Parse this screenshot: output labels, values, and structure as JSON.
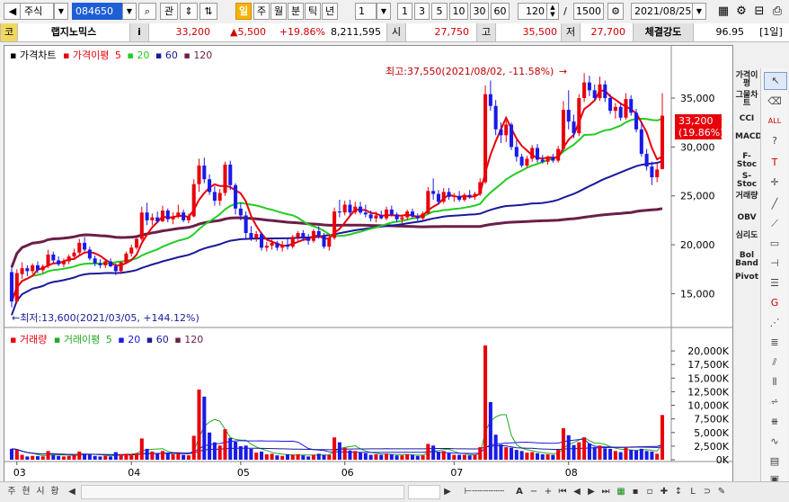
{
  "toolbar": {
    "market": "주식",
    "code": "084650",
    "btn_gwan": "관",
    "periods": [
      "일",
      "주",
      "월",
      "분",
      "틱",
      "년"
    ],
    "period_count": "1",
    "quick_counts": [
      "1",
      "3",
      "5",
      "10",
      "30",
      "60"
    ],
    "display_count": "120",
    "separator": "/",
    "total_count": "1500",
    "date": "2021/08/25"
  },
  "info": {
    "market_abbr": "코",
    "name": "랩지노믹스",
    "info_btn": "i",
    "price": "33,200",
    "change": "▲5,500",
    "change_rate": "+19.86%",
    "volume": "8,211,595",
    "open_label": "시",
    "open": "27,750",
    "high_label": "고",
    "high": "35,500",
    "low_label": "저",
    "low": "27,700",
    "strength_label": "체결강도",
    "strength": "96.95",
    "period_tag": "[1일]"
  },
  "price_panel": {
    "legend_title": "가격차트",
    "legend_ma_label": "가격이평",
    "legend_ma": [
      "5",
      "20",
      "60",
      "120"
    ],
    "max_note": "최고:37,550(2021/08/02, -11.58%)",
    "max_arrow": "→",
    "min_note": "←최저:13,600(2021/03/05, +144.12%)",
    "y_ticks": [
      "35,000",
      "30,000",
      "25,000",
      "20,000",
      "15,000"
    ],
    "current_price_tag": "33,200",
    "current_rate_tag": "(19.86%)"
  },
  "volume_panel": {
    "legend_title": "거래량",
    "legend_ma_label": "거래이평",
    "legend_ma": [
      "5",
      "20",
      "60",
      "120"
    ],
    "y_ticks": [
      "20,000K",
      "17,500K",
      "15,000K",
      "12,500K",
      "10,000K",
      "7,500K",
      "5,000K",
      "2,500K",
      "0K"
    ]
  },
  "x_ticks": [
    "03",
    "04",
    "05",
    "06",
    "07",
    "08"
  ],
  "colors": {
    "up": "#e8000b",
    "down": "#1a1ae6",
    "ma5": "#e8000b",
    "ma20": "#22cc22",
    "ma60": "#1a1a9a",
    "ma120": "#6b1f48"
  },
  "indicators": [
    "가격이평",
    "그물차트",
    "CCI",
    "MACD",
    "F-Stoc",
    "S-Stoc",
    "거래량",
    "OBV",
    "심리도",
    "Bol Band",
    "Pivot"
  ],
  "bottom": {
    "tabs": [
      "주",
      "현",
      "시",
      "황"
    ],
    "zoom_label": "A"
  },
  "chart_data": {
    "type": "candlestick",
    "dates_range": [
      "2021/02/26",
      "2021/08/25"
    ],
    "ylim_price": [
      12000,
      38500
    ],
    "ylim_volume_k": [
      0,
      21000
    ],
    "points_ohlc_vol_k": [
      [
        17200,
        17800,
        13600,
        14200,
        2000
      ],
      [
        14200,
        17500,
        14000,
        17100,
        1800
      ],
      [
        17000,
        18200,
        16500,
        17600,
        900
      ],
      [
        17600,
        17900,
        16800,
        17300,
        600
      ],
      [
        17300,
        18100,
        17000,
        17900,
        700
      ],
      [
        17900,
        18300,
        17100,
        17400,
        650
      ],
      [
        17400,
        18000,
        17100,
        17800,
        600
      ],
      [
        17800,
        19500,
        17600,
        19000,
        1600
      ],
      [
        19000,
        19300,
        18100,
        18400,
        900
      ],
      [
        18400,
        18800,
        17800,
        18000,
        700
      ],
      [
        18000,
        18600,
        17700,
        18300,
        600
      ],
      [
        18300,
        19000,
        18000,
        18800,
        700
      ],
      [
        18800,
        19600,
        18500,
        19200,
        800
      ],
      [
        19200,
        20600,
        19000,
        20200,
        1500
      ],
      [
        20200,
        20800,
        19300,
        19500,
        1100
      ],
      [
        19500,
        19800,
        18400,
        18600,
        900
      ],
      [
        18600,
        18900,
        17800,
        18100,
        700
      ],
      [
        18100,
        18500,
        17600,
        17900,
        600
      ],
      [
        17900,
        18500,
        17600,
        18300,
        700
      ],
      [
        18300,
        18600,
        17700,
        17800,
        600
      ],
      [
        17800,
        18100,
        16900,
        17300,
        1400
      ],
      [
        17300,
        18300,
        17000,
        18200,
        1000
      ],
      [
        18200,
        19300,
        18000,
        19100,
        1100
      ],
      [
        19100,
        20000,
        18800,
        19700,
        1000
      ],
      [
        19700,
        20700,
        19500,
        20600,
        1200
      ],
      [
        20600,
        23900,
        20400,
        23300,
        3900
      ],
      [
        23300,
        24300,
        22000,
        22500,
        2000
      ],
      [
        22500,
        23200,
        22000,
        22800,
        1500
      ],
      [
        22800,
        23400,
        22200,
        22400,
        1200
      ],
      [
        22400,
        24000,
        22300,
        23500,
        1600
      ],
      [
        23500,
        23700,
        22300,
        22600,
        1300
      ],
      [
        22600,
        23300,
        22100,
        22900,
        1000
      ],
      [
        22900,
        24100,
        22700,
        23300,
        1200
      ],
      [
        23300,
        23600,
        22300,
        22500,
        900
      ],
      [
        22500,
        23200,
        22200,
        22900,
        800
      ],
      [
        22900,
        26700,
        22800,
        26200,
        4400
      ],
      [
        26200,
        28800,
        25400,
        28100,
        12900
      ],
      [
        28100,
        28900,
        26300,
        26700,
        11600
      ],
      [
        26700,
        27200,
        25100,
        25400,
        5000
      ],
      [
        25400,
        26000,
        24000,
        24500,
        3200
      ],
      [
        24500,
        25700,
        24000,
        25300,
        2600
      ],
      [
        25300,
        28500,
        25000,
        28200,
        5600
      ],
      [
        28200,
        28600,
        25600,
        26100,
        4000
      ],
      [
        26100,
        26300,
        23100,
        23700,
        3300
      ],
      [
        23700,
        24300,
        22500,
        23000,
        2500
      ],
      [
        23000,
        23400,
        20500,
        21200,
        2600
      ],
      [
        21200,
        21900,
        20400,
        20700,
        2000
      ],
      [
        20700,
        21400,
        20300,
        21100,
        1300
      ],
      [
        21100,
        21300,
        19400,
        19700,
        1500
      ],
      [
        19700,
        20300,
        19300,
        19900,
        1000
      ],
      [
        19900,
        20600,
        19500,
        20200,
        1100
      ],
      [
        20200,
        20400,
        19400,
        19700,
        800
      ],
      [
        19700,
        20400,
        19300,
        20000,
        700
      ],
      [
        20000,
        20700,
        19500,
        19800,
        1000
      ],
      [
        19800,
        21000,
        19600,
        20800,
        900
      ],
      [
        20800,
        21400,
        20400,
        21200,
        1000
      ],
      [
        21200,
        21500,
        20400,
        20700,
        800
      ],
      [
        20700,
        21100,
        20000,
        20400,
        600
      ],
      [
        20400,
        21600,
        20200,
        21400,
        900
      ],
      [
        21400,
        21900,
        20600,
        20900,
        1100
      ],
      [
        20900,
        21200,
        19600,
        19800,
        900
      ],
      [
        19800,
        21100,
        19400,
        20700,
        900
      ],
      [
        20700,
        23800,
        20500,
        23400,
        4100
      ],
      [
        23400,
        24600,
        22800,
        23300,
        3200
      ],
      [
        23300,
        24500,
        23000,
        24100,
        2200
      ],
      [
        24100,
        24600,
        23000,
        23300,
        1700
      ],
      [
        23300,
        24400,
        23100,
        23900,
        1600
      ],
      [
        23900,
        24400,
        23100,
        23300,
        1300
      ],
      [
        23300,
        24100,
        22800,
        23100,
        1200
      ],
      [
        23100,
        23500,
        22400,
        22700,
        900
      ],
      [
        22700,
        23400,
        22300,
        23000,
        1000
      ],
      [
        23000,
        23500,
        22600,
        22700,
        900
      ],
      [
        22700,
        23900,
        22500,
        23600,
        1100
      ],
      [
        23600,
        24000,
        22900,
        23100,
        1000
      ],
      [
        23100,
        23300,
        22300,
        22600,
        800
      ],
      [
        22600,
        23100,
        22200,
        22800,
        800
      ],
      [
        22800,
        23600,
        22500,
        23400,
        1000
      ],
      [
        23400,
        23700,
        22700,
        22900,
        900
      ],
      [
        22900,
        23200,
        22400,
        22700,
        700
      ],
      [
        22700,
        23400,
        22500,
        23200,
        800
      ],
      [
        23200,
        25900,
        23100,
        25500,
        2900
      ],
      [
        25500,
        26800,
        24600,
        25200,
        2600
      ],
      [
        25200,
        25600,
        24100,
        24400,
        1400
      ],
      [
        24400,
        25800,
        24200,
        25400,
        1600
      ],
      [
        25400,
        25800,
        24600,
        24900,
        1200
      ],
      [
        24900,
        25300,
        24400,
        25000,
        900
      ],
      [
        25000,
        25500,
        24400,
        24600,
        900
      ],
      [
        24600,
        25300,
        24400,
        25100,
        900
      ],
      [
        25100,
        25600,
        24700,
        24900,
        800
      ],
      [
        24900,
        25400,
        24600,
        25200,
        900
      ],
      [
        25200,
        26800,
        25000,
        26400,
        2300
      ],
      [
        26400,
        36300,
        26200,
        35400,
        21000
      ],
      [
        35400,
        36800,
        33700,
        34200,
        10600
      ],
      [
        34200,
        34800,
        31200,
        31800,
        4600
      ],
      [
        31800,
        32500,
        30400,
        31200,
        2800
      ],
      [
        31200,
        32700,
        30500,
        32300,
        2300
      ],
      [
        32300,
        32500,
        29700,
        30000,
        2200
      ],
      [
        30000,
        30700,
        28500,
        29000,
        1800
      ],
      [
        29000,
        29300,
        27900,
        28100,
        1600
      ],
      [
        28100,
        29100,
        27900,
        28800,
        1300
      ],
      [
        28800,
        30200,
        28500,
        29900,
        1400
      ],
      [
        29900,
        30300,
        28400,
        28700,
        1200
      ],
      [
        28700,
        29200,
        28300,
        28500,
        1000
      ],
      [
        28500,
        29100,
        28200,
        28900,
        1000
      ],
      [
        28900,
        29300,
        28400,
        28600,
        900
      ],
      [
        28600,
        30100,
        28400,
        29800,
        1800
      ],
      [
        29800,
        34700,
        29600,
        33800,
        5800
      ],
      [
        33800,
        35800,
        31800,
        32600,
        4500
      ],
      [
        32600,
        33300,
        30900,
        31400,
        2700
      ],
      [
        31400,
        35400,
        31100,
        35000,
        3200
      ],
      [
        35000,
        37550,
        34600,
        36600,
        4100
      ],
      [
        36600,
        37300,
        35200,
        35800,
        3000
      ],
      [
        35800,
        36400,
        34800,
        35000,
        2300
      ],
      [
        35000,
        37200,
        34700,
        36400,
        2600
      ],
      [
        36400,
        36800,
        34600,
        35000,
        2100
      ],
      [
        35000,
        35400,
        33400,
        33700,
        2000
      ],
      [
        33700,
        34500,
        32900,
        34100,
        1600
      ],
      [
        34100,
        34500,
        32700,
        33000,
        1400
      ],
      [
        33000,
        35500,
        32800,
        34900,
        2200
      ],
      [
        34900,
        35300,
        33200,
        33500,
        1800
      ],
      [
        33500,
        33900,
        31500,
        31800,
        1700
      ],
      [
        31800,
        32600,
        29000,
        29300,
        2000
      ],
      [
        29300,
        29800,
        27600,
        28000,
        1600
      ],
      [
        28000,
        28500,
        26100,
        26900,
        1500
      ],
      [
        26900,
        28300,
        26400,
        27700,
        1100
      ],
      [
        27750,
        35500,
        27700,
        33200,
        8212
      ]
    ]
  }
}
